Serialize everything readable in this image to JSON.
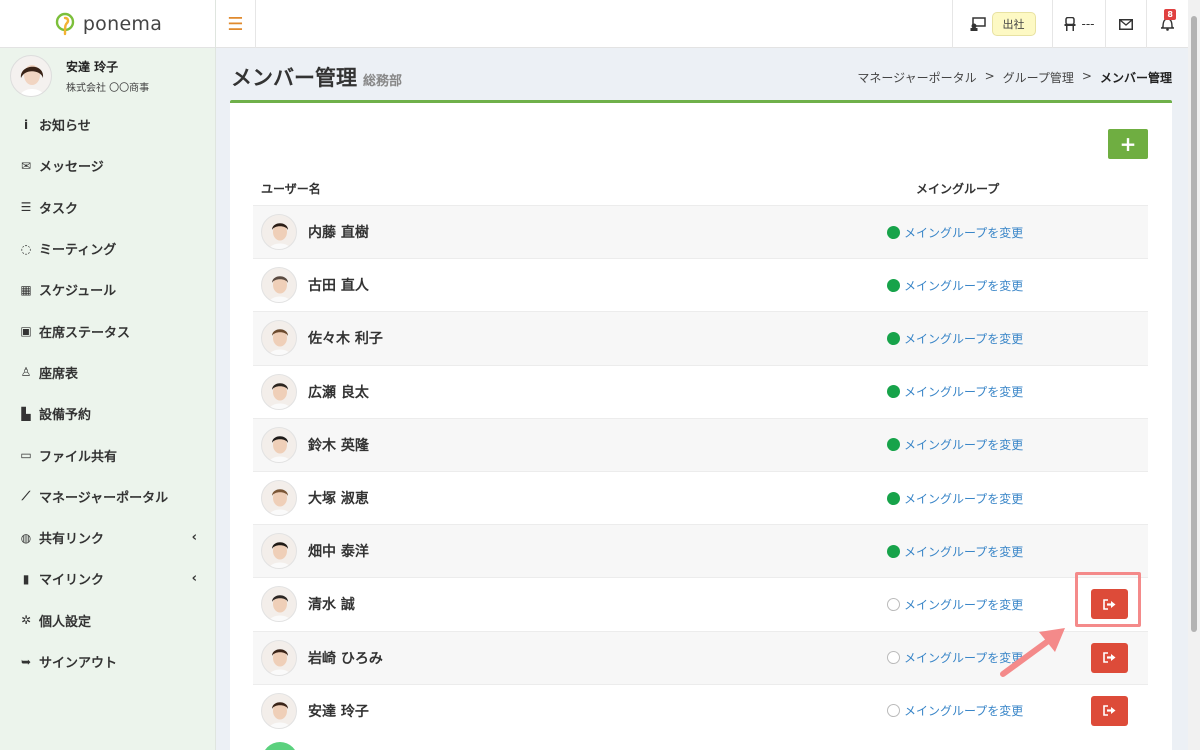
{
  "app": {
    "name": "ponema"
  },
  "user": {
    "name": "安達 玲子",
    "company": "株式会社 〇〇商事"
  },
  "nav": [
    {
      "label": "お知らせ",
      "icon": "info-circle-icon",
      "glyph": "i"
    },
    {
      "label": "メッセージ",
      "icon": "envelope-icon",
      "glyph": "✉"
    },
    {
      "label": "タスク",
      "icon": "task-list-icon",
      "glyph": "☰"
    },
    {
      "label": "ミーティング",
      "icon": "chat-bubbles-icon",
      "glyph": "◌"
    },
    {
      "label": "スケジュール",
      "icon": "calendar-icon",
      "glyph": "▦"
    },
    {
      "label": "在席ステータス",
      "icon": "presence-icon",
      "glyph": "▣"
    },
    {
      "label": "座席表",
      "icon": "chair-icon",
      "glyph": "♙"
    },
    {
      "label": "設備予約",
      "icon": "door-icon",
      "glyph": "▙"
    },
    {
      "label": "ファイル共有",
      "icon": "folder-icon",
      "glyph": "▭"
    },
    {
      "label": "マネージャーポータル",
      "icon": "chart-line-icon",
      "glyph": "⟋"
    },
    {
      "label": "共有リンク",
      "icon": "globe-icon",
      "glyph": "◍",
      "expandable": true
    },
    {
      "label": "マイリンク",
      "icon": "bookmark-icon",
      "glyph": "▮",
      "expandable": true
    },
    {
      "label": "個人設定",
      "icon": "gear-icon",
      "glyph": "✲"
    },
    {
      "label": "サインアウト",
      "icon": "sign-out-icon",
      "glyph": "➥"
    }
  ],
  "topbar": {
    "status": "出社",
    "seat": "---",
    "notifications": "8"
  },
  "page": {
    "title": "メンバー管理",
    "subtitle": "総務部",
    "breadcrumb": [
      "マネージャーポータル",
      ">",
      "グループ管理",
      ">",
      "メンバー管理"
    ]
  },
  "table": {
    "col_user": "ユーザー名",
    "col_group": "メイングループ",
    "change_label": "メイングループを変更",
    "rows": [
      {
        "name": "内藤 直樹",
        "main": true,
        "leave": false
      },
      {
        "name": "古田 直人",
        "main": true,
        "leave": false
      },
      {
        "name": "佐々木 利子",
        "main": true,
        "leave": false
      },
      {
        "name": "広瀬 良太",
        "main": true,
        "leave": false
      },
      {
        "name": "鈴木 英隆",
        "main": true,
        "leave": false
      },
      {
        "name": "大塚 淑恵",
        "main": true,
        "leave": false
      },
      {
        "name": "畑中 泰洋",
        "main": true,
        "leave": false
      },
      {
        "name": "清水 誠",
        "main": false,
        "leave": true
      },
      {
        "name": "岩崎 ひろみ",
        "main": false,
        "leave": true
      },
      {
        "name": "安達 玲子",
        "main": false,
        "leave": true
      }
    ]
  },
  "colors": {
    "accent": "#6fb04a",
    "danger": "#dd4b39",
    "link": "#3a86c8",
    "highlight": "#f48a8a"
  }
}
